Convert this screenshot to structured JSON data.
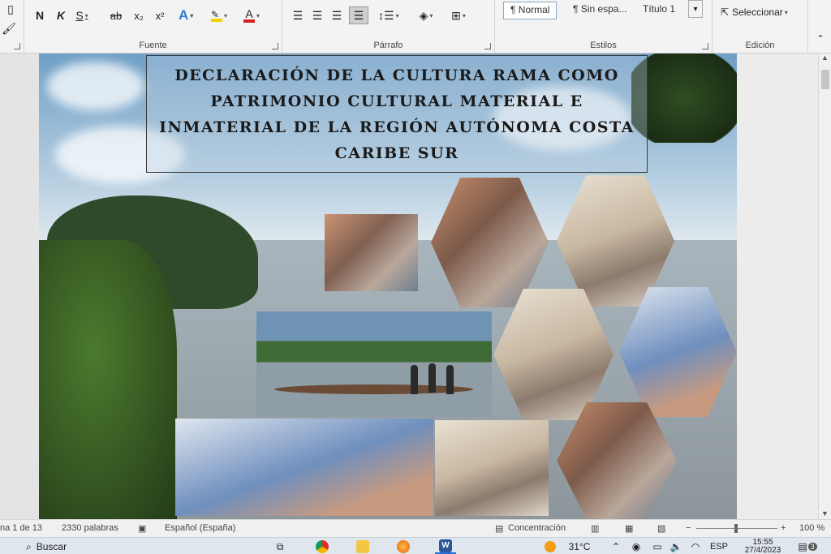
{
  "ribbon": {
    "fuente": {
      "label": "Fuente",
      "bold": "N",
      "italic": "K",
      "underline": "S",
      "strike": "ab",
      "subscript": "x₂",
      "superscript": "x²",
      "text_effects": "A",
      "font_color": "A"
    },
    "parrafo": {
      "label": "Párrafo"
    },
    "estilos": {
      "label": "Estilos",
      "items": [
        "¶ Normal",
        "¶ Sin espa...",
        "Título 1"
      ]
    },
    "edicion": {
      "label": "Edición",
      "select": "Seleccionar"
    }
  },
  "document": {
    "title": "DECLARACIÓN DE LA CULTURA RAMA COMO PATRIMONIO CULTURAL MATERIAL E INMATERIAL DE LA REGIÓN AUTÓNOMA COSTA CARIBE SUR"
  },
  "statusbar": {
    "page": "na 1 de 13",
    "words": "2330 palabras",
    "language": "Español (España)",
    "focus": "Concentración",
    "zoom": "100 %"
  },
  "taskbar": {
    "search": "Buscar",
    "temperature": "31°C",
    "lang": "ESP",
    "time": "15:55",
    "date": "27/4/2023",
    "notifications": "3"
  },
  "colors": {
    "ribbon_bg": "#f3f3f3",
    "underline_highlight": "#f2d400",
    "font_color_red": "#d21f1f",
    "text_effects_blue": "#2b7cd3"
  }
}
